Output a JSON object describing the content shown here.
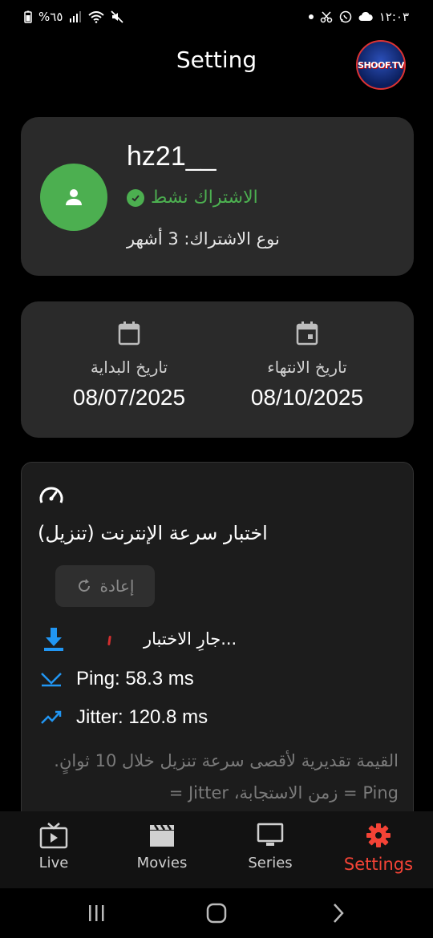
{
  "status_bar": {
    "time": "١٢:٠٣",
    "battery": "%٦٥"
  },
  "header": {
    "title": "Setting",
    "logo_text": "SHOOF.TV"
  },
  "profile": {
    "username": "hz21__",
    "status": "الاشتراك نشط",
    "subscription_type": "نوع الاشتراك: 3 أشهر",
    "status_color": "#4caf50"
  },
  "dates": {
    "start_label": "تاريخ البداية",
    "start_value": "08/07/2025",
    "end_label": "تاريخ الانتهاء",
    "end_value": "08/10/2025"
  },
  "speed_test": {
    "title": "اختبار سرعة الإنترنت (تنزيل)",
    "retry_label": "إعادة",
    "running_text": "جارِ الاختبار...",
    "ping": "Ping: 58.3 ms",
    "jitter": "Jitter: 120.8 ms",
    "note": "القيمة تقديرية لأقصى سرعة تنزيل خلال 10 ثوانٍ. Ping = زمن الاستجابة، Jitter ="
  },
  "bottom_nav": {
    "live": "Live",
    "movies": "Movies",
    "series": "Series",
    "settings": "Settings",
    "active": "settings",
    "active_color": "#f44336"
  },
  "icons": {
    "speedometer": "speedometer-icon",
    "download": "download-icon",
    "ping": "ping-icon",
    "jitter": "jitter-icon",
    "refresh": "refresh-icon"
  }
}
